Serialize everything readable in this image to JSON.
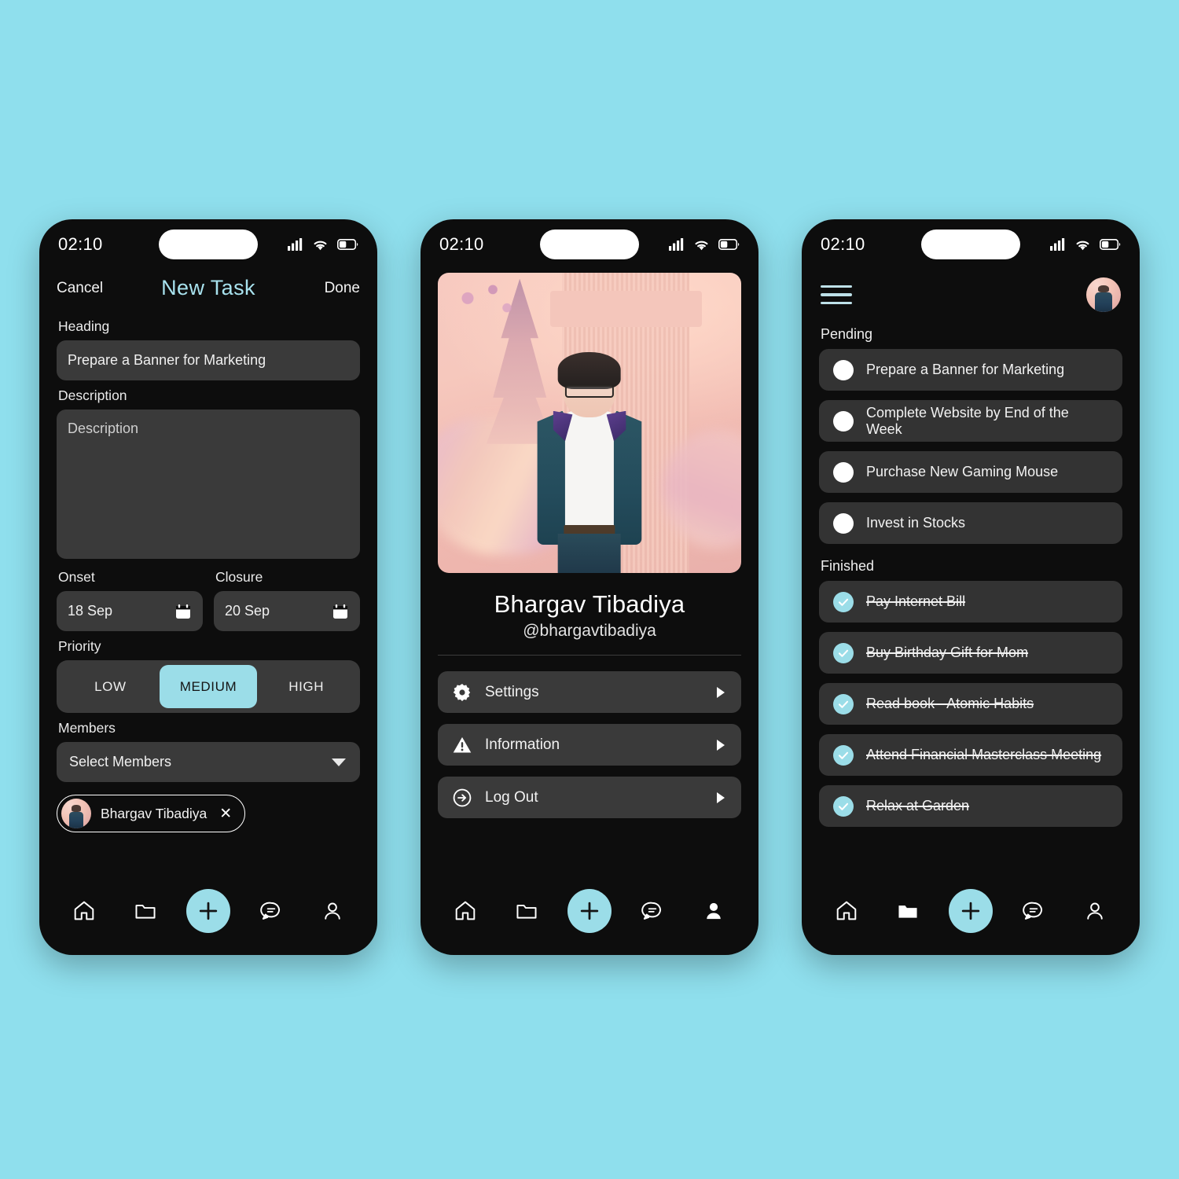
{
  "theme": {
    "background": "#8fdfed",
    "phone_bg": "#0d0d0d",
    "card": "#3a3a3a",
    "accent": "#9bdde8",
    "text": "#f2f2f2"
  },
  "status_bar": {
    "time": "02:10",
    "icons": [
      "cellular-signal-icon",
      "wifi-icon",
      "battery-icon"
    ],
    "battery_level": 40
  },
  "phone1": {
    "nav": {
      "cancel_label": "Cancel",
      "title": "New Task",
      "done_label": "Done"
    },
    "heading": {
      "label": "Heading",
      "value": "Prepare a Banner for Marketing",
      "placeholder": "Heading"
    },
    "description": {
      "label": "Description",
      "value": "",
      "placeholder": "Description"
    },
    "onset": {
      "label": "Onset",
      "value": "18 Sep"
    },
    "closure": {
      "label": "Closure",
      "value": "20 Sep"
    },
    "priority": {
      "label": "Priority",
      "options": [
        "LOW",
        "MEDIUM",
        "HIGH"
      ],
      "selected": "MEDIUM"
    },
    "members": {
      "label": "Members",
      "placeholder": "Select Members",
      "selected": [
        {
          "name": "Bhargav Tibadiya",
          "remove_label": "✕"
        }
      ]
    }
  },
  "phone2": {
    "profile": {
      "name": "Bhargav Tibadiya",
      "handle": "@bhargavtibadiya"
    },
    "menu": [
      {
        "icon": "gear-icon",
        "label": "Settings",
        "chevron": "▶"
      },
      {
        "icon": "warning-icon",
        "label": "Information",
        "chevron": "▶"
      },
      {
        "icon": "logout-icon",
        "label": "Log Out",
        "chevron": "▶"
      }
    ]
  },
  "phone3": {
    "header": {
      "menu_icon": "hamburger-menu-icon",
      "avatar": "user-avatar"
    },
    "sections": [
      {
        "title": "Pending",
        "tasks": [
          {
            "text": "Prepare a Banner for Marketing",
            "done": false
          },
          {
            "text": "Complete Website by End of the Week",
            "done": false
          },
          {
            "text": "Purchase New Gaming Mouse",
            "done": false
          },
          {
            "text": "Invest in Stocks",
            "done": false
          }
        ]
      },
      {
        "title": "Finished",
        "tasks": [
          {
            "text": "Pay Internet Bill",
            "done": true
          },
          {
            "text": "Buy Birthday Gift for Mom",
            "done": true
          },
          {
            "text": "Read book - Atomic Habits",
            "done": true
          },
          {
            "text": "Attend Financial Masterclass Meeting",
            "done": true
          },
          {
            "text": "Relax at Garden",
            "done": true
          }
        ]
      }
    ]
  },
  "bottom_nav": {
    "items": [
      "home-icon",
      "folder-icon",
      "add-icon",
      "chat-icon",
      "profile-icon"
    ],
    "active": {
      "phone1": null,
      "phone2": "profile-icon",
      "phone3": "folder-icon"
    }
  }
}
